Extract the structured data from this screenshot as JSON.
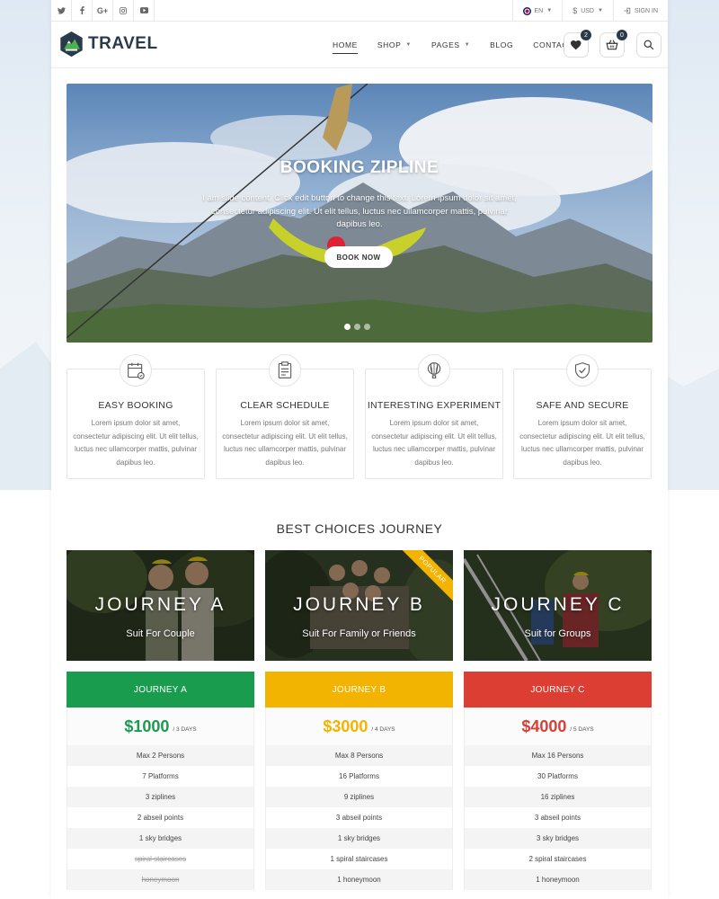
{
  "topbar": {
    "social": [
      "t",
      "f",
      "G+",
      "ig",
      "yt"
    ],
    "language": "EN",
    "currency": "USD",
    "signin": "SIGN IN"
  },
  "header": {
    "logo_text": "TRAVEL",
    "nav": [
      {
        "label": "HOME",
        "active": true
      },
      {
        "label": "SHOP",
        "dropdown": true
      },
      {
        "label": "PAGES",
        "dropdown": true
      },
      {
        "label": "BLOG"
      },
      {
        "label": "CONTACT US"
      }
    ],
    "wishlist_count": "2",
    "cart_count": "0"
  },
  "hero": {
    "title": "BOOKING ZIPLINE",
    "text": "I am slide content. Click edit button to change this text. Lorem ipsum dolor sit amet, consectetur adipiscing elit. Ut elit tellus, luctus nec ullamcorper mattis, pulvinar dapibus leo.",
    "button": "BOOK NOW",
    "slides": 3,
    "active_slide": 1
  },
  "features": [
    {
      "icon": "calendar-icon",
      "title": "EASY BOOKING",
      "text": "Lorem ipsum dolor sit amet, consectetur adipiscing elit. Ut elit tellus, luctus nec ullamcorper mattis, pulvinar dapibus leo."
    },
    {
      "icon": "clipboard-icon",
      "title": "CLEAR SCHEDULE",
      "text": "Lorem ipsum dolor sit amet, consectetur adipiscing elit. Ut elit tellus, luctus nec ullamcorper mattis, pulvinar dapibus leo."
    },
    {
      "icon": "balloon-icon",
      "title": "INTERESTING EXPERIMENT",
      "text": "Lorem ipsum dolor sit amet, consectetur adipiscing elit. Ut elit tellus, luctus nec ullamcorper mattis, pulvinar dapibus leo."
    },
    {
      "icon": "shield-check-icon",
      "title": "SAFE AND SECURE",
      "text": "Lorem ipsum dolor sit amet, consectetur adipiscing elit. Ut elit tellus, luctus nec ullamcorper mattis, pulvinar dapibus leo."
    }
  ],
  "section_title": "BEST CHOICES JOURNEY",
  "journeys": [
    {
      "title": "JOURNEY A",
      "subtitle": "Suit For Couple"
    },
    {
      "title": "JOURNEY B",
      "subtitle": "Suit For Family or Friends",
      "ribbon": "POPULAR"
    },
    {
      "title": "JOURNEY C",
      "subtitle": "Suit for Groups"
    }
  ],
  "pricing": [
    {
      "name": "JOURNEY A",
      "color": "#1a9c4e",
      "price": "$1000",
      "period": "/ 3 DAYS",
      "rows": [
        "Max 2 Persons",
        "7 Platforms",
        "3 ziplines",
        "2 abseil points",
        "1 sky bridges",
        "spiral staircases",
        "honeymoon"
      ],
      "struck": [
        5,
        6
      ]
    },
    {
      "name": "JOURNEY B",
      "color": "#f2b400",
      "price": "$3000",
      "period": "/ 4 DAYS",
      "rows": [
        "Max 8 Persons",
        "16 Platforms",
        "9 ziplines",
        "3 abseil points",
        "1 sky bridges",
        "1 spiral staircases",
        "1 honeymoon"
      ],
      "struck": []
    },
    {
      "name": "JOURNEY C",
      "color": "#dc3e34",
      "price": "$4000",
      "period": "/ 5 DAYS",
      "rows": [
        "Max 16 Persons",
        "30 Platforms",
        "16 ziplines",
        "3 abseil points",
        "3 sky bridges",
        "2 spiral staircases",
        "1 honeymoon"
      ],
      "struck": []
    }
  ]
}
